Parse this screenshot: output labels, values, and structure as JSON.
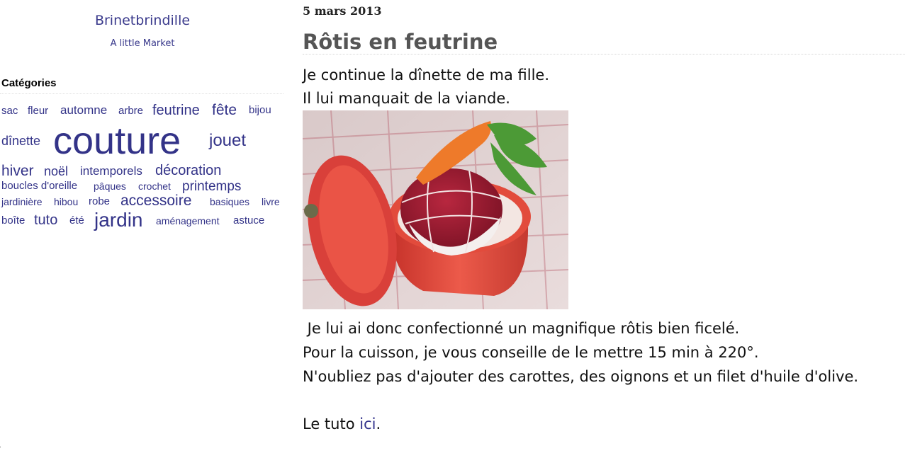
{
  "sidebar": {
    "blog_title": "Brinetbrindille",
    "blog_description": "A little Market",
    "categories_heading": "Catégories",
    "tags": [
      {
        "label": "sac"
      },
      {
        "label": "fleur"
      },
      {
        "label": "automne"
      },
      {
        "label": "arbre"
      },
      {
        "label": "feutrine"
      },
      {
        "label": "fête"
      },
      {
        "label": "bijou"
      },
      {
        "label": "dînette"
      },
      {
        "label": "couture"
      },
      {
        "label": "jouet"
      },
      {
        "label": "hiver"
      },
      {
        "label": "noël"
      },
      {
        "label": "intemporels"
      },
      {
        "label": "décoration"
      },
      {
        "label": "boucles d'oreille"
      },
      {
        "label": "pâques"
      },
      {
        "label": "crochet"
      },
      {
        "label": "printemps"
      },
      {
        "label": "jardinière"
      },
      {
        "label": "hibou"
      },
      {
        "label": "robe"
      },
      {
        "label": "accessoire"
      },
      {
        "label": "basiques"
      },
      {
        "label": "livre"
      },
      {
        "label": "boîte"
      },
      {
        "label": "tuto"
      },
      {
        "label": "été"
      },
      {
        "label": "jardin"
      },
      {
        "label": "aménagement"
      },
      {
        "label": "astuce"
      }
    ]
  },
  "post": {
    "date": "5 mars 2013",
    "title": "Rôtis en feutrine",
    "intro_lines": [
      "Je continue la dînette de ma fille.",
      "Il lui manquait de la viande."
    ],
    "body_lines": [
      " Je lui ai donc confectionné un magnifique rôtis bien ficelé.",
      "Pour la cuisson, je vous conseille de le mettre 15 min à 220°.",
      "N'oubliez pas d'ajouter des carottes, des oignons et un filet d'huile d'olive."
    ],
    "tuto_prefix": "Le tuto ",
    "tuto_link": "ici",
    "tuto_suffix": "."
  },
  "colors": {
    "link": "#333388",
    "title": "#555555",
    "text": "#111111"
  }
}
